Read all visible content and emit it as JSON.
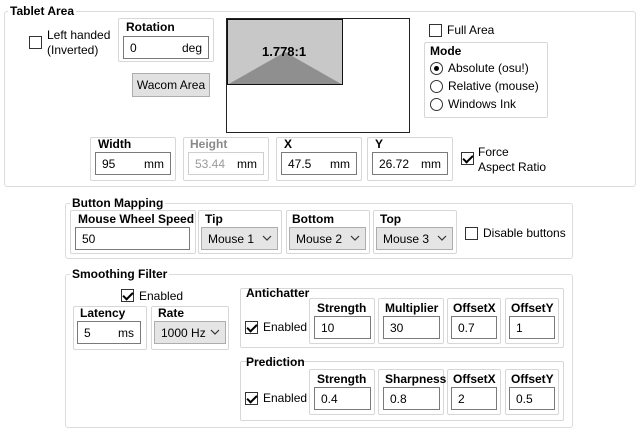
{
  "tablet_area": {
    "title": "Tablet Area",
    "left_handed_label": "Left handed\n(Inverted)",
    "left_handed_checked": false,
    "rotation": {
      "label": "Rotation",
      "value": "0",
      "unit": "deg"
    },
    "wacom_area_label": "Wacom Area",
    "preview": {
      "ratio_label": "1.778:1"
    },
    "full_area": {
      "label": "Full Area",
      "checked": false
    },
    "mode": {
      "title": "Mode",
      "options": [
        {
          "label": "Absolute (osu!)",
          "selected": true
        },
        {
          "label": "Relative (mouse)",
          "selected": false
        },
        {
          "label": "Windows Ink",
          "selected": false
        }
      ]
    },
    "width": {
      "label": "Width",
      "value": "95",
      "unit": "mm"
    },
    "height": {
      "label": "Height",
      "value": "53.44",
      "unit": "mm"
    },
    "x": {
      "label": "X",
      "value": "47.5",
      "unit": "mm"
    },
    "y": {
      "label": "Y",
      "value": "26.72",
      "unit": "mm"
    },
    "force_aspect": {
      "label": "Force\nAspect Ratio",
      "checked": true
    }
  },
  "button_mapping": {
    "title": "Button Mapping",
    "mouse_wheel_speed": {
      "label": "Mouse Wheel Speed",
      "value": "50"
    },
    "tip": {
      "label": "Tip",
      "value": "Mouse 1"
    },
    "bottom": {
      "label": "Bottom",
      "value": "Mouse 2"
    },
    "top": {
      "label": "Top",
      "value": "Mouse 3"
    },
    "disable_buttons": {
      "label": "Disable buttons",
      "checked": false
    }
  },
  "smoothing": {
    "title": "Smoothing Filter",
    "enabled": {
      "label": "Enabled",
      "checked": true
    },
    "latency": {
      "label": "Latency",
      "value": "5",
      "unit": "ms"
    },
    "rate": {
      "label": "Rate",
      "value": "1000 Hz"
    },
    "antichatter": {
      "title": "Antichatter",
      "enabled": {
        "label": "Enabled",
        "checked": true
      },
      "strength": {
        "label": "Strength",
        "value": "10"
      },
      "multiplier": {
        "label": "Multiplier",
        "value": "30"
      },
      "offset_x": {
        "label": "OffsetX",
        "value": "0.7"
      },
      "offset_y": {
        "label": "OffsetY",
        "value": "1"
      }
    },
    "prediction": {
      "title": "Prediction",
      "enabled": {
        "label": "Enabled",
        "checked": true
      },
      "strength": {
        "label": "Strength",
        "value": "0.4"
      },
      "sharpness": {
        "label": "Sharpness",
        "value": "0.8"
      },
      "offset_x": {
        "label": "OffsetX",
        "value": "2"
      },
      "offset_y": {
        "label": "OffsetY",
        "value": "0.5"
      }
    }
  }
}
